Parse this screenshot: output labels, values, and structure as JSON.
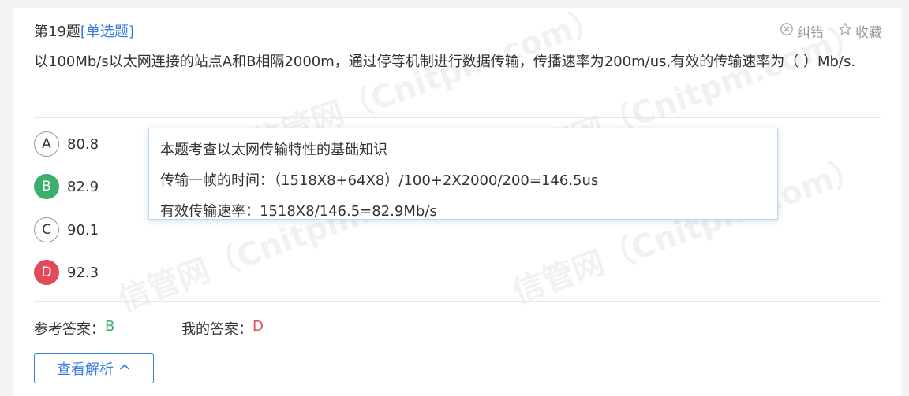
{
  "question": {
    "number_label": "第19题",
    "type_label": "[单选题]",
    "stem": "以100Mb/s以太网连接的站点A和B相隔2000m，通过停等机制进行数据传输，传播速率为200m/us,有效的传输速率为（ ）Mb/s."
  },
  "actions": {
    "report_label": "纠错",
    "favorite_label": "收藏"
  },
  "options": [
    {
      "letter": "A",
      "text": "80.8",
      "state": "normal"
    },
    {
      "letter": "B",
      "text": "82.9",
      "state": "correct"
    },
    {
      "letter": "C",
      "text": "90.1",
      "state": "normal"
    },
    {
      "letter": "D",
      "text": "92.3",
      "state": "wrong"
    }
  ],
  "tooltip": {
    "line1": "本题考查以太网传输特性的基础知识",
    "line2": "传输一帧的时间：（1518X8+64X8）/100+2X2000/200=146.5us",
    "line3": "有效传输速率：1518X8/146.5=82.9Mb/s"
  },
  "answers": {
    "reference_label": "参考答案：",
    "reference_value": "B",
    "mine_label": "我的答案：",
    "mine_value": "D"
  },
  "explain_button": {
    "label": "查看解析"
  },
  "colors": {
    "accent": "#3b7cde",
    "correct": "#3bb06b",
    "wrong": "#e04a5a"
  }
}
